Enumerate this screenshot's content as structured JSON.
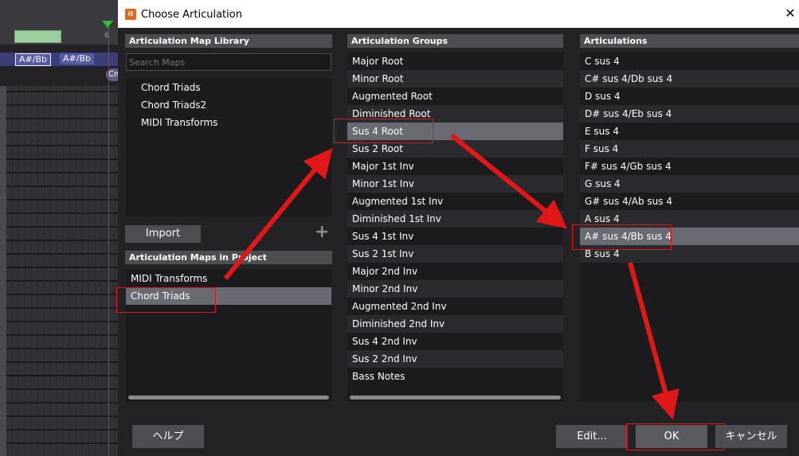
{
  "background": {
    "ruler_number": "6",
    "chord_chips": [
      "A#/Bb",
      "A#/Bb"
    ],
    "chip_partial": "Cm"
  },
  "dialog": {
    "title": "Choose Articulation",
    "title_icon": "app-logo-icon",
    "close": "✕"
  },
  "library": {
    "header": "Articulation Map Library",
    "search_placeholder": "Search Maps",
    "items": [
      "Chord Triads",
      "Chord Triads2",
      "MIDI Transforms"
    ],
    "import_label": "Import",
    "add_label": "+"
  },
  "project": {
    "header": "Articulation Maps in Project",
    "items": [
      "MIDI Transforms",
      "Chord Triads"
    ],
    "selected": "Chord Triads"
  },
  "groups": {
    "header": "Articulation Groups",
    "items": [
      "Major Root",
      "Minor Root",
      "Augmented Root",
      "Diminished Root",
      "Sus 4 Root",
      "Sus 2 Root",
      "Major 1st Inv",
      "Minor 1st Inv",
      "Augmented 1st Inv",
      "Diminished 1st Inv",
      "Sus 4 1st Inv",
      "Sus 2 1st Inv",
      "Major 2nd Inv",
      "Minor 2nd Inv",
      "Augmented 2nd Inv",
      "Diminished 2nd Inv",
      "Sus 4 2nd Inv",
      "Sus 2 2nd Inv",
      "Bass Notes"
    ],
    "selected": "Sus 4 Root"
  },
  "articulations": {
    "header": "Articulations",
    "items": [
      "C sus 4",
      "C# sus 4/Db sus 4",
      "D sus 4",
      "D# sus 4/Eb sus 4",
      "E sus 4",
      "F sus 4",
      "F# sus 4/Gb sus 4",
      "G sus 4",
      "G# sus 4/Ab sus 4",
      "A sus 4",
      "A# sus 4/Bb sus 4",
      "B sus 4"
    ],
    "selected": "A# sus 4/Bb sus 4"
  },
  "footer": {
    "help_label": "ヘルプ",
    "edit_label": "Edit...",
    "ok_label": "OK",
    "cancel_label": "キャンセル"
  },
  "colors": {
    "annotation": "#e01818",
    "selection": "#6a6a72"
  }
}
